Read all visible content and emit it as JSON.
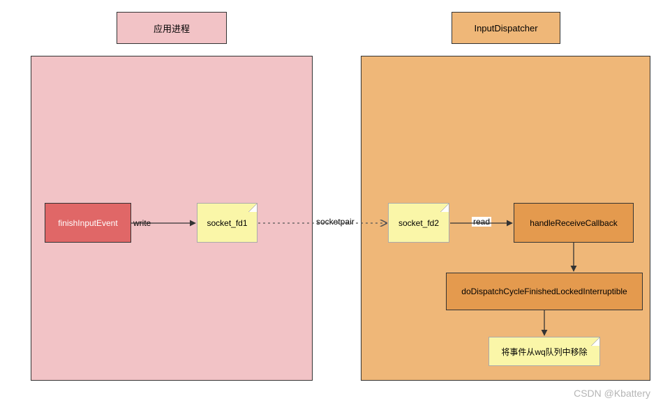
{
  "left": {
    "title": "应用进程",
    "node1": "finishInputEvent",
    "note": "socket_fd1",
    "edge_label": "write"
  },
  "middle": {
    "label": "socketpair"
  },
  "right": {
    "title": "InputDispatcher",
    "note1": "socket_fd2",
    "edge_label": "read",
    "node1": "handleReceiveCallback",
    "node2": "doDispatchCycleFinishedLockedInterruptible",
    "note2": "将事件从wq队列中移除"
  },
  "watermark": "CSDN @Kbattery"
}
